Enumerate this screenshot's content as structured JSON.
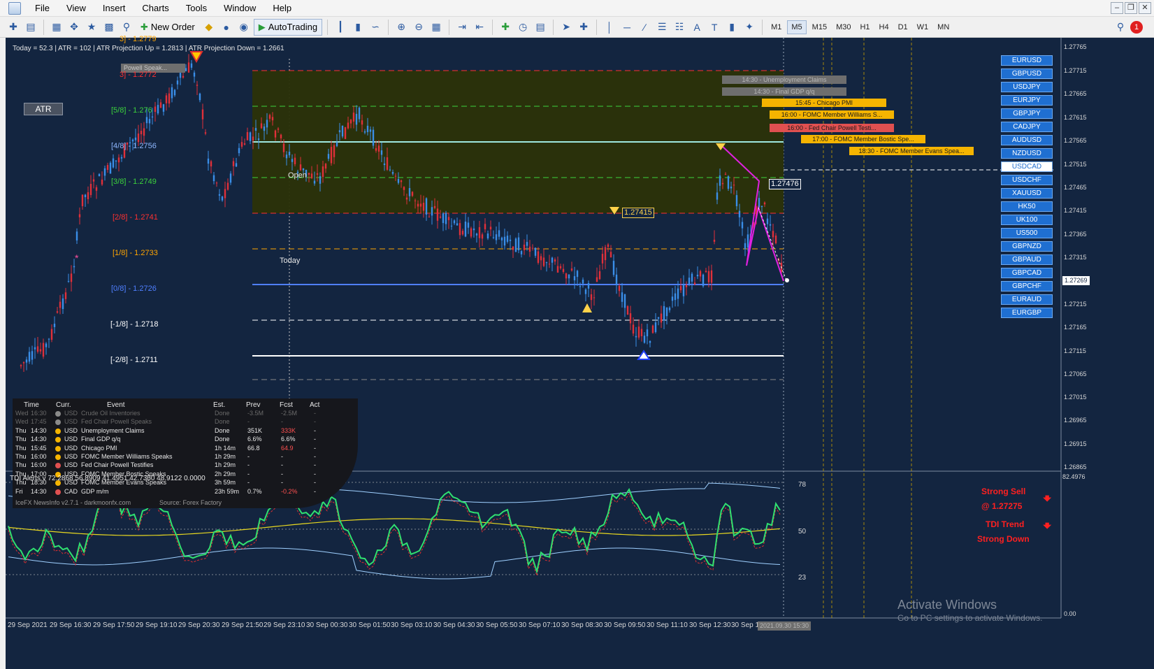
{
  "menu": {
    "items": [
      "File",
      "View",
      "Insert",
      "Charts",
      "Tools",
      "Window",
      "Help"
    ]
  },
  "toolbar": {
    "new_order_label": "New Order",
    "autotrading_label": "AutoTrading",
    "periods": [
      "M1",
      "M5",
      "M15",
      "M30",
      "H1",
      "H4",
      "D1",
      "W1",
      "MN"
    ],
    "active_period": "M5"
  },
  "chart": {
    "header_info": "Today = 52.3   |   ATR = 102   |   ATR Projection Up = 1.2813   |   ATR Projection Down = 1.2661",
    "atr_button_label": "ATR",
    "murrey_levels": [
      {
        "label": "3] - 1.2779",
        "color": "#ffa500"
      },
      {
        "label": "3] - 1.2772",
        "color": "#ff3030"
      },
      {
        "label": "[5/8] - 1.276",
        "color": "#3cd23c"
      },
      {
        "label": "[4/8] - 1.2756",
        "color": "#8fb8ff"
      },
      {
        "label": "[3/8] - 1.2749",
        "color": "#3cd23c"
      },
      {
        "label": "[2/8] - 1.2741",
        "color": "#ff3030"
      },
      {
        "label": "[1/8] - 1.2733",
        "color": "#ffa500"
      },
      {
        "label": "[0/8] - 1.2726",
        "color": "#4f7fff"
      },
      {
        "label": "[-1/8] - 1.2718",
        "color": "#ffffff"
      },
      {
        "label": "[-2/8] - 1.2711",
        "color": "#ffffff"
      }
    ],
    "powell_tag": "Powell Speak...",
    "open_label": "Open",
    "today_label": "Today",
    "price_tag_1": "1.27415",
    "price_tag_2": "1.27476",
    "current_price": "1.27269",
    "price_ticks": [
      "1.27765",
      "1.27715",
      "1.27665",
      "1.27615",
      "1.27565",
      "1.27515",
      "1.27465",
      "1.27415",
      "1.27365",
      "1.27315",
      "1.27215",
      "1.27165",
      "1.27115",
      "1.27065",
      "1.27015",
      "1.26965",
      "1.26915",
      "1.26865"
    ],
    "event_bars": [
      {
        "text": "14:30 - Unemployment Claims",
        "bg": "#6e6e6e",
        "fg": "#b8b8b8"
      },
      {
        "text": "14:30 - Final GDP q/q",
        "bg": "#6e6e6e",
        "fg": "#b8b8b8"
      },
      {
        "text": "15:45 - Chicago PMI",
        "bg": "#f5b400",
        "fg": "#1a1a1a"
      },
      {
        "text": "16:00 - FOMC Member Williams S...",
        "bg": "#f5b400",
        "fg": "#1a1a1a"
      },
      {
        "text": "16:00 - Fed Chair Powell Testi...",
        "bg": "#e05050",
        "fg": "#1a1a1a"
      },
      {
        "text": "17:00 - FOMC Member Bostic Spe...",
        "bg": "#f5b400",
        "fg": "#1a1a1a"
      },
      {
        "text": "18:30 - FOMC Member Evans Spea...",
        "bg": "#f5b400",
        "fg": "#1a1a1a"
      }
    ],
    "symbols": [
      "EURUSD",
      "GBPUSD",
      "USDJPY",
      "EURJPY",
      "GBPJPY",
      "CADJPY",
      "AUDUSD",
      "NZDUSD",
      "USDCAD",
      "USDCHF",
      "XAUUSD",
      "HK50",
      "UK100",
      "US500",
      "GBPNZD",
      "GBPAUD",
      "GBPCAD",
      "GBPCHF",
      "EURAUD",
      "EURGBP"
    ],
    "active_symbol": "USDCAD",
    "time_ticks": [
      "29 Sep 2021",
      "29 Sep 16:30",
      "29 Sep 17:50",
      "29 Sep 19:10",
      "29 Sep 20:30",
      "29 Sep 21:50",
      "29 Sep 23:10",
      "30 Sep 00:30",
      "30 Sep 01:50",
      "30 Sep 03:10",
      "30 Sep 04:30",
      "30 Sep 05:50",
      "30 Sep 07:10",
      "30 Sep 08:30",
      "30 Sep 09:50",
      "30 Sep 11:10",
      "30 Sep 12:30",
      "30 Sep 13"
    ],
    "time_cursor_label": "2021.09.30 15:30",
    "watermark_title": "Activate Windows",
    "watermark_sub": "Go to PC settings to activate Windows."
  },
  "news": {
    "headers": [
      "Time",
      "Curr.",
      "Event",
      "Est.",
      "Prev",
      "Fcst",
      "Act"
    ],
    "rows": [
      {
        "day": "Wed",
        "time": "16:30",
        "curr": "USD",
        "event": "Crude Oil Inventories",
        "est": "Done",
        "prev": "-3.5M",
        "fcst": "-2.5M",
        "act": "-",
        "past": true,
        "dot": "#8a8a8a",
        "fcst_color": "#8a8a8a"
      },
      {
        "day": "Wed",
        "time": "17:45",
        "curr": "USD",
        "event": "Fed Chair Powell Speaks",
        "est": "Done",
        "prev": "-",
        "fcst": "-",
        "act": "-",
        "past": true,
        "dot": "#8a8a8a",
        "fcst_color": "#8a8a8a"
      },
      {
        "day": "Thu",
        "time": "14:30",
        "curr": "USD",
        "event": "Unemployment Claims",
        "est": "Done",
        "prev": "351K",
        "fcst": "333K",
        "act": "-",
        "past": false,
        "dot": "#f5b400",
        "fcst_color": "#ff5050"
      },
      {
        "day": "Thu",
        "time": "14:30",
        "curr": "USD",
        "event": "Final GDP q/q",
        "est": "Done",
        "prev": "6.6%",
        "fcst": "6.6%",
        "act": "-",
        "past": false,
        "dot": "#f5b400",
        "fcst_color": "#e8e8e8"
      },
      {
        "day": "Thu",
        "time": "15:45",
        "curr": "USD",
        "event": "Chicago PMI",
        "est": "1h 14m",
        "prev": "66.8",
        "fcst": "64.9",
        "act": "-",
        "past": false,
        "dot": "#f5b400",
        "fcst_color": "#ff5050"
      },
      {
        "day": "Thu",
        "time": "16:00",
        "curr": "USD",
        "event": "FOMC Member Williams Speaks",
        "est": "1h 29m",
        "prev": "-",
        "fcst": "-",
        "act": "-",
        "past": false,
        "dot": "#f5b400",
        "fcst_color": "#e8e8e8"
      },
      {
        "day": "Thu",
        "time": "16:00",
        "curr": "USD",
        "event": "Fed Chair Powell Testifies",
        "est": "1h 29m",
        "prev": "-",
        "fcst": "-",
        "act": "-",
        "past": false,
        "dot": "#e05050",
        "fcst_color": "#e8e8e8"
      },
      {
        "day": "Thu",
        "time": "17:00",
        "curr": "USD",
        "event": "FOMC Member Bostic Speaks",
        "est": "2h 29m",
        "prev": "-",
        "fcst": "-",
        "act": "-",
        "past": false,
        "dot": "#f5b400",
        "fcst_color": "#e8e8e8"
      },
      {
        "day": "Thu",
        "time": "18:30",
        "curr": "USD",
        "event": "FOMC Member Evans Speaks",
        "est": "3h 59m",
        "prev": "-",
        "fcst": "-",
        "act": "-",
        "past": false,
        "dot": "#f5b400",
        "fcst_color": "#e8e8e8"
      },
      {
        "day": "Fri",
        "time": "14:30",
        "curr": "CAD",
        "event": "GDP m/m",
        "est": "23h 59m",
        "prev": "0.7%",
        "fcst": "-0.2%",
        "act": "-",
        "past": false,
        "dot": "#e05050",
        "fcst_color": "#ff5050"
      }
    ],
    "footer_left": "IceFX NewsInfo v2.7.1 - darkmoonfx.com",
    "footer_right": "Source: Forex Factory"
  },
  "tdi": {
    "header": "TDI Alerts v 72.2868 56.8909 41.4951 42.7360 48.9122 0.0000",
    "scale_top": "82.4976",
    "scale_bottom": "0.00",
    "level_78": "78",
    "level_50": "50",
    "level_23": "23",
    "alert_1": "Strong Sell",
    "alert_2": "@ 1.27275",
    "alert_3": "TDI Trend",
    "alert_4": "Strong Down"
  }
}
